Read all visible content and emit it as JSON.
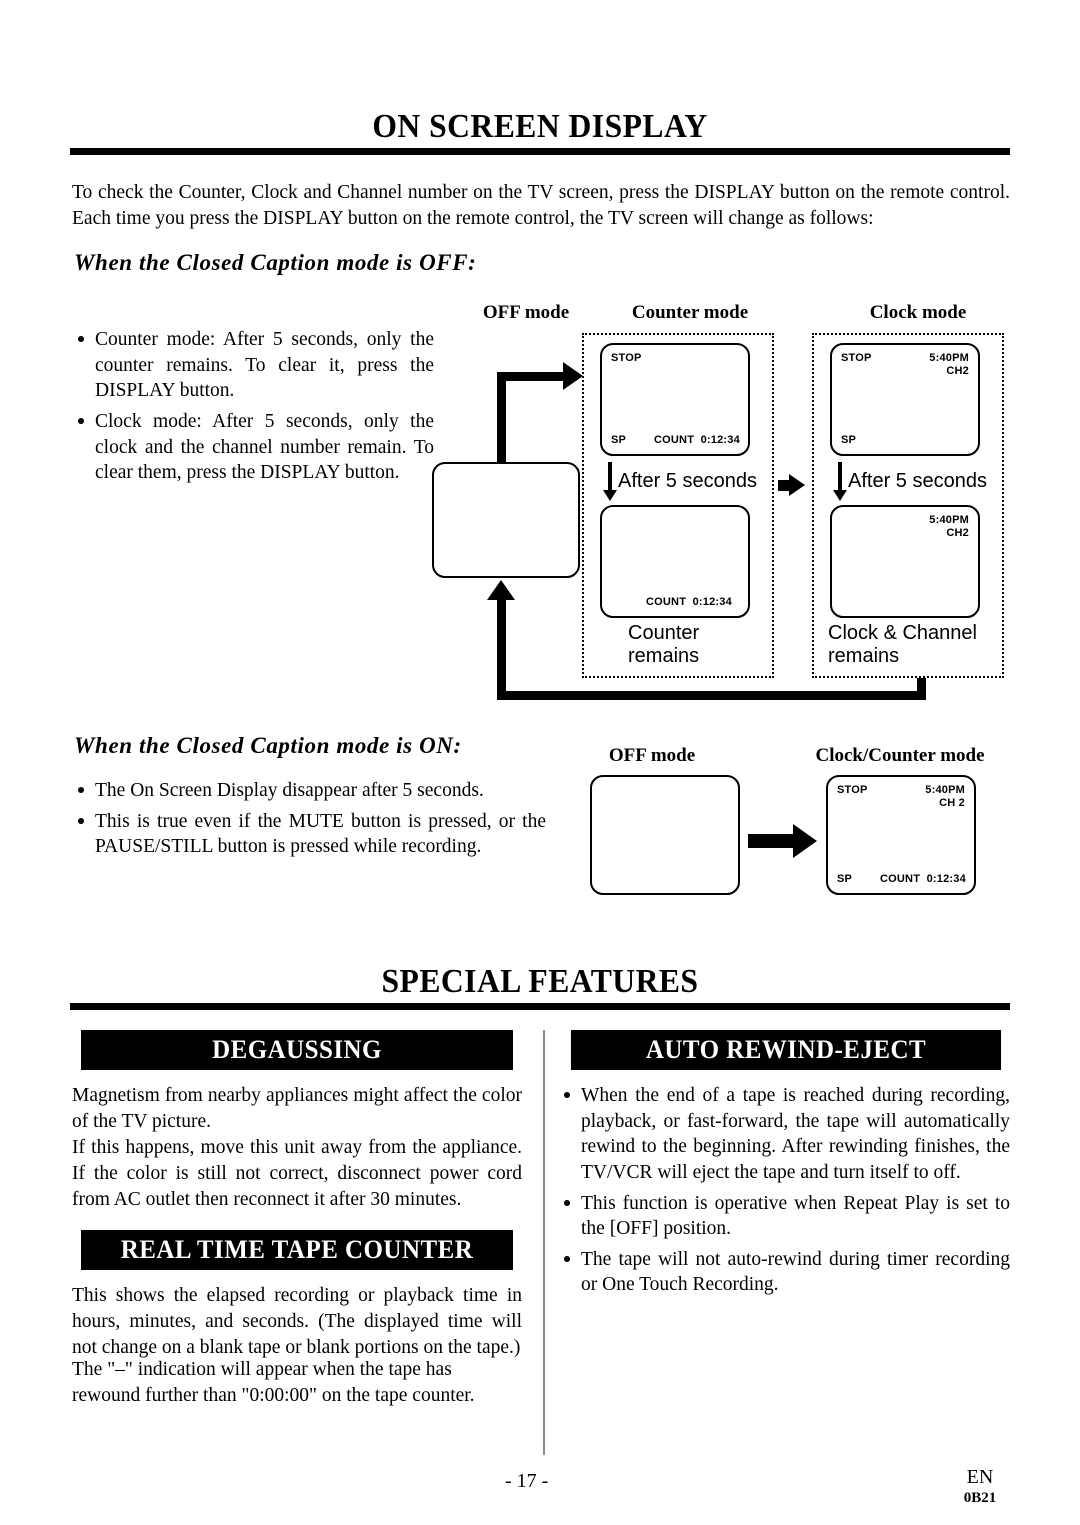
{
  "section1": {
    "title": "ON SCREEN DISPLAY",
    "intro": "To check the Counter, Clock and Channel number on the TV screen, press the DISPLAY button on the remote control. Each time you press the DISPLAY button on the remote control, the TV screen will change as follows:",
    "subhead_off": "When the Closed Caption mode is OFF:",
    "subhead_on": "When the Closed Caption mode is ON:",
    "bullets_off": [
      "Counter mode: After 5 seconds, only the counter remains. To clear it, press the DISPLAY button.",
      "Clock mode: After 5 seconds, only the clock and the channel number remain. To clear them, press the DISPLAY button."
    ],
    "bullets_on": [
      "The On Screen Display disappear after 5 seconds.",
      "This is true even if the MUTE button is pressed, or the PAUSE/STILL button is pressed while recording."
    ]
  },
  "diagram_off": {
    "col_labels": {
      "off_mode": "OFF mode",
      "counter_mode": "Counter mode",
      "clock_mode": "Clock mode"
    },
    "after_label": "After 5 seconds",
    "counter_caption": "Counter\nremains",
    "clock_caption": "Clock & Channel\nremains",
    "screens": {
      "counter_top": {
        "status": "STOP",
        "speed": "SP",
        "counter": "COUNT  0:12:34"
      },
      "counter_bottom": {
        "counter": "COUNT  0:12:34"
      },
      "clock_top": {
        "status": "STOP",
        "time": "5:40PM",
        "channel": "CH2",
        "speed": "SP"
      },
      "clock_bottom": {
        "time": "5:40PM",
        "channel": "CH2"
      }
    }
  },
  "diagram_on": {
    "col_labels": {
      "off_mode": "OFF mode",
      "clock_counter_mode": "Clock/Counter mode"
    },
    "screen": {
      "status": "STOP",
      "time": "5:40PM",
      "channel": "CH 2",
      "speed": "SP",
      "counter": "COUNT  0:12:34"
    }
  },
  "section2": {
    "title": "SPECIAL FEATURES",
    "degaussing": {
      "banner": "DEGAUSSING",
      "paragraphs": [
        "Magnetism from nearby appliances might affect the color of the TV picture.",
        "If this happens, move this unit away from the appliance. If the color is still not correct, disconnect power cord from AC outlet then reconnect it after 30 minutes."
      ]
    },
    "real_time_tape_counter": {
      "banner": "REAL TIME TAPE COUNTER",
      "paragraphs": [
        "This shows the elapsed recording or playback time in hours, minutes, and seconds. (The displayed time will not change on a blank tape or blank portions on the tape.)",
        "The \"–\" indication will appear when the tape has rewound further than \"0:00:00\" on the tape counter."
      ]
    },
    "auto_rewind_eject": {
      "banner": "AUTO REWIND-EJECT",
      "bullets": [
        "When the end of a tape is reached during recording, playback, or fast-forward, the tape will automatically rewind to the beginning. After rewinding finishes, the TV/VCR will eject the tape and turn itself to off.",
        "This function is operative when Repeat Play is set to the [OFF] position.",
        "The tape will not auto-rewind during timer recording or One Touch Recording."
      ]
    }
  },
  "footer": {
    "page_number": "- 17 -",
    "language": "EN",
    "code": "0B21"
  }
}
